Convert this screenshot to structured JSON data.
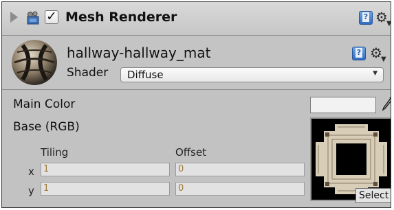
{
  "component": {
    "title": "Mesh Renderer",
    "enabled_mark": "✓",
    "icons": [
      "foldout-arrow-icon",
      "mesh-renderer-icon",
      "help-icon",
      "gear-icon"
    ]
  },
  "material": {
    "name": "hallway-hallway_mat",
    "shader_label": "Shader",
    "shader_value": "Diffuse",
    "dropdown_arrow": "▼"
  },
  "properties": {
    "main_color_label": "Main Color",
    "main_color_value": "#f2f2f2",
    "base_label": "Base (RGB)",
    "tiling_label": "Tiling",
    "offset_label": "Offset",
    "x_label": "x",
    "y_label": "y",
    "tiling_x": "1",
    "tiling_y": "1",
    "offset_x": "0",
    "offset_y": "0",
    "select_label": "Select"
  },
  "colors": {
    "panel_bg": "#c2c2c2",
    "field_text": "#a07a3a",
    "help_blue": "#3f7fd0"
  }
}
